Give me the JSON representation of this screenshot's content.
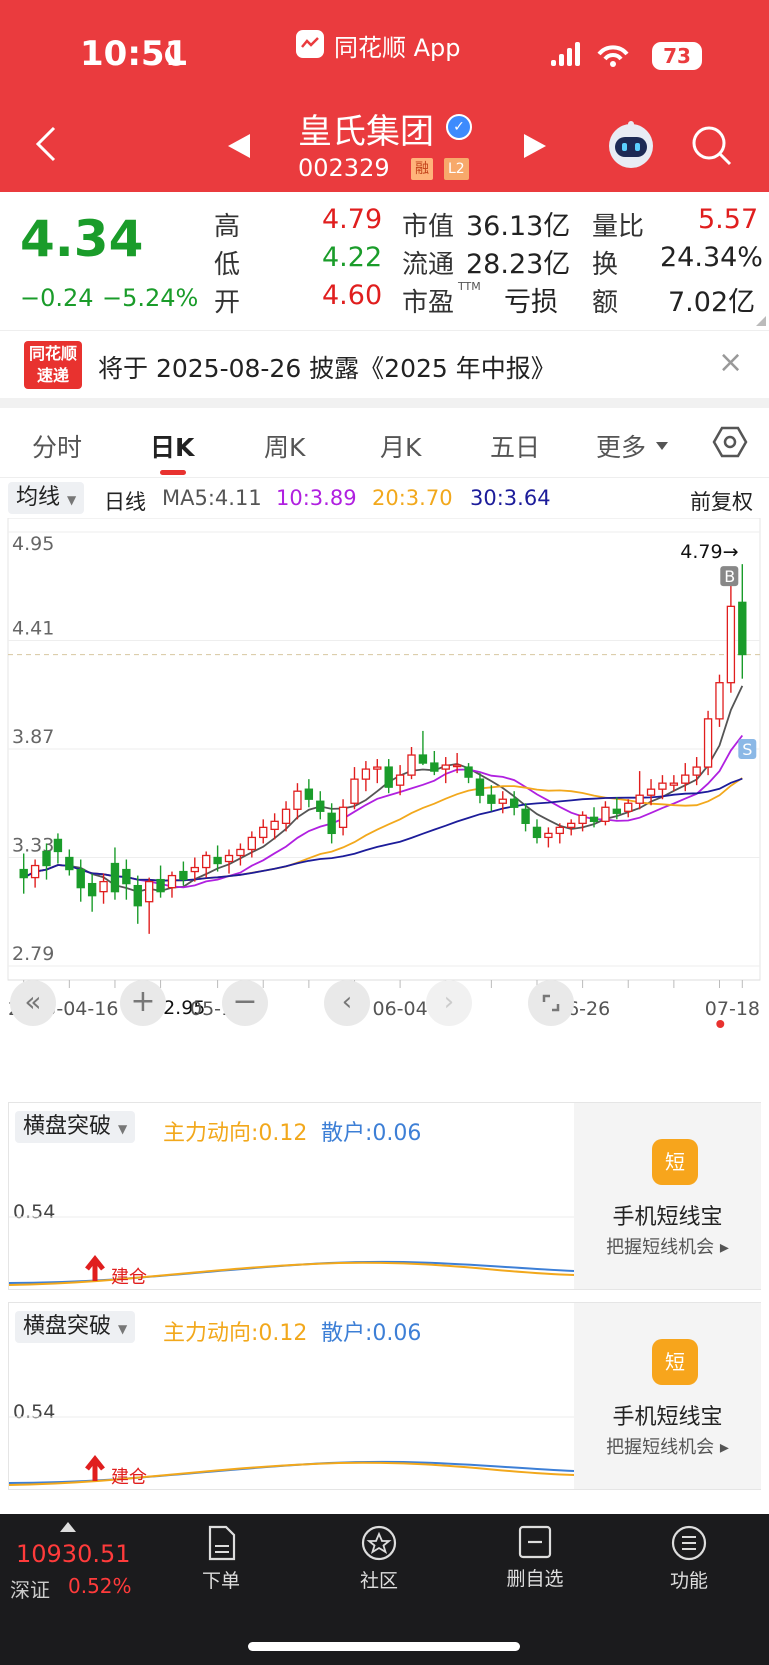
{
  "status_bar": {
    "time": "10:51",
    "app_name": "同花顺 App",
    "battery": "73"
  },
  "header": {
    "stock_name": "皇氏集团",
    "stock_code": "002329",
    "tag_margin": "融",
    "tag_level": "L2"
  },
  "quote": {
    "price": "4.34",
    "change": "−0.24",
    "change_pct": "−5.24%",
    "high_label": "高",
    "high": "4.79",
    "low_label": "低",
    "low": "4.22",
    "open_label": "开",
    "open": "4.60",
    "mktcap_label": "市值",
    "mktcap": "36.13亿",
    "float_label": "流通",
    "float": "28.23亿",
    "pe_label": "市盈",
    "pe_sup": "TTM",
    "pe": "亏损",
    "volratio_label": "量比",
    "volratio": "5.57",
    "turnover_label": "换",
    "turnover": "24.34%",
    "amount_label": "额",
    "amount": "7.02亿"
  },
  "notice": {
    "logo_line1": "同花顺",
    "logo_line2": "速递",
    "text": "将于 2025-08-26 披露《2025 年中报》",
    "close": "×"
  },
  "tabs": [
    "分时",
    "日K",
    "周K",
    "月K",
    "五日",
    "更多"
  ],
  "ma_bar": {
    "selector": "均线",
    "period": "日线",
    "ma5": "MA5:4.11",
    "ma10": "10:3.89",
    "ma20": "20:3.70",
    "ma30": "30:3.64",
    "adjust": "前复权"
  },
  "colors": {
    "up": "#e01e1e",
    "down": "#1a9c2a",
    "ma5": "#555555",
    "ma10": "#b020e0",
    "ma20": "#f2a81c",
    "ma30": "#1c1c9a",
    "header": "#ea3b3e"
  },
  "chart_data": {
    "type": "candlestick",
    "ylim": [
      2.79,
      4.95
    ],
    "y_ticks": [
      "4.95",
      "4.41",
      "3.87",
      "3.33",
      "2.79"
    ],
    "x_ticks": [
      "2025-04-16",
      "05-12",
      "06-04",
      "06-26",
      "07-18"
    ],
    "high_marker": "4.79→",
    "low_marker": "←2.95",
    "marker_buy": "B",
    "marker_sell": "S",
    "current_price_line": 4.34,
    "ohlc": [
      [
        3.27,
        3.35,
        3.15,
        3.23
      ],
      [
        3.23,
        3.32,
        3.18,
        3.29
      ],
      [
        3.36,
        3.4,
        3.22,
        3.29
      ],
      [
        3.42,
        3.45,
        3.3,
        3.36
      ],
      [
        3.33,
        3.37,
        3.24,
        3.27
      ],
      [
        3.27,
        3.32,
        3.11,
        3.18
      ],
      [
        3.2,
        3.25,
        3.06,
        3.14
      ],
      [
        3.16,
        3.25,
        3.1,
        3.21
      ],
      [
        3.3,
        3.38,
        3.12,
        3.16
      ],
      [
        3.27,
        3.32,
        3.12,
        3.2
      ],
      [
        3.19,
        3.24,
        3.0,
        3.09
      ],
      [
        3.11,
        3.23,
        2.95,
        3.21
      ],
      [
        3.22,
        3.29,
        3.13,
        3.16
      ],
      [
        3.18,
        3.26,
        3.13,
        3.24
      ],
      [
        3.26,
        3.31,
        3.19,
        3.22
      ],
      [
        3.26,
        3.33,
        3.21,
        3.28
      ],
      [
        3.28,
        3.36,
        3.23,
        3.34
      ],
      [
        3.33,
        3.39,
        3.26,
        3.3
      ],
      [
        3.31,
        3.37,
        3.25,
        3.34
      ],
      [
        3.34,
        3.4,
        3.29,
        3.37
      ],
      [
        3.37,
        3.46,
        3.33,
        3.43
      ],
      [
        3.43,
        3.52,
        3.4,
        3.48
      ],
      [
        3.47,
        3.55,
        3.42,
        3.51
      ],
      [
        3.5,
        3.61,
        3.46,
        3.57
      ],
      [
        3.57,
        3.7,
        3.52,
        3.66
      ],
      [
        3.67,
        3.72,
        3.58,
        3.62
      ],
      [
        3.61,
        3.66,
        3.52,
        3.56
      ],
      [
        3.55,
        3.6,
        3.4,
        3.45
      ],
      [
        3.48,
        3.62,
        3.44,
        3.58
      ],
      [
        3.6,
        3.78,
        3.57,
        3.72
      ],
      [
        3.72,
        3.81,
        3.66,
        3.77
      ],
      [
        3.77,
        3.82,
        3.7,
        3.78
      ],
      [
        3.78,
        3.82,
        3.65,
        3.68
      ],
      [
        3.69,
        3.79,
        3.64,
        3.74
      ],
      [
        3.74,
        3.88,
        3.72,
        3.84
      ],
      [
        3.84,
        3.96,
        3.79,
        3.8
      ],
      [
        3.8,
        3.86,
        3.74,
        3.76
      ],
      [
        3.77,
        3.83,
        3.7,
        3.79
      ],
      [
        3.79,
        3.85,
        3.75,
        3.79
      ],
      [
        3.78,
        3.8,
        3.7,
        3.73
      ],
      [
        3.72,
        3.75,
        3.6,
        3.64
      ],
      [
        3.64,
        3.69,
        3.56,
        3.6
      ],
      [
        3.6,
        3.66,
        3.55,
        3.62
      ],
      [
        3.62,
        3.66,
        3.54,
        3.58
      ],
      [
        3.57,
        3.6,
        3.46,
        3.5
      ],
      [
        3.48,
        3.52,
        3.4,
        3.43
      ],
      [
        3.43,
        3.48,
        3.38,
        3.45
      ],
      [
        3.45,
        3.5,
        3.4,
        3.48
      ],
      [
        3.48,
        3.52,
        3.44,
        3.5
      ],
      [
        3.5,
        3.56,
        3.46,
        3.54
      ],
      [
        3.53,
        3.58,
        3.48,
        3.51
      ],
      [
        3.51,
        3.61,
        3.49,
        3.58
      ],
      [
        3.57,
        3.63,
        3.52,
        3.55
      ],
      [
        3.56,
        3.62,
        3.53,
        3.6
      ],
      [
        3.6,
        3.76,
        3.57,
        3.64
      ],
      [
        3.64,
        3.72,
        3.59,
        3.67
      ],
      [
        3.67,
        3.74,
        3.62,
        3.7
      ],
      [
        3.69,
        3.74,
        3.66,
        3.7
      ],
      [
        3.7,
        3.8,
        3.66,
        3.74
      ],
      [
        3.74,
        3.83,
        3.69,
        3.78
      ],
      [
        3.78,
        4.06,
        3.74,
        4.02
      ],
      [
        4.02,
        4.24,
        3.98,
        4.2
      ],
      [
        4.2,
        4.7,
        4.15,
        4.58
      ],
      [
        4.6,
        4.79,
        4.22,
        4.34
      ]
    ]
  },
  "panels": [
    {
      "selector": "横盘突破",
      "main": "主力动向:0.12",
      "retail": "散户:0.06",
      "tick": "0.54",
      "signal": "建仓",
      "ad_icon": "短",
      "ad_title": "手机短线宝",
      "ad_sub": "把握短线机会"
    },
    {
      "selector": "横盘突破",
      "main": "主力动向:0.12",
      "retail": "散户:0.06",
      "tick": "0.54",
      "signal": "建仓",
      "ad_icon": "短",
      "ad_title": "手机短线宝",
      "ad_sub": "把握短线机会"
    }
  ],
  "footer": {
    "index_value": "10930.51",
    "index_name": "深证",
    "index_pct": "0.52%",
    "items": [
      "下单",
      "社区",
      "删自选",
      "功能"
    ]
  }
}
